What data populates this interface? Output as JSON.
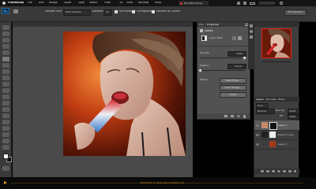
{
  "menu": {
    "app": "Photoshop",
    "items": [
      "File",
      "Edit",
      "Image",
      "Layer",
      "Type",
      "Select",
      "Filter",
      "3D",
      "View",
      "Window",
      "Help"
    ],
    "recording": "Now Recording"
  },
  "options": {
    "sample_size_label": "Sample Size:",
    "sample_size_value": "Point Sample",
    "tolerance_label": "Tolerance:",
    "tolerance_value": "32",
    "anti_alias": "Anti-alias",
    "contiguous": "Contiguous",
    "sample_all": "Sample All Layers",
    "workspace": "Photography"
  },
  "properties": {
    "tabs": [
      "Info",
      "Properties"
    ],
    "title": "Masks",
    "mask_type": "Layer Mask",
    "density_label": "Density:",
    "density_value": "100%",
    "feather_label": "Feather:",
    "feather_value": "0.0 px",
    "refine_label": "Refine:",
    "mask_edge_button": "Mask Edge...",
    "color_range_button": "Color Range...",
    "invert_button": "Invert"
  },
  "layers_panel": {
    "tabs": [
      "Layers",
      "Channels",
      "Paths"
    ],
    "kind": "Kind",
    "blend_mode": "Normal",
    "opacity_label": "Opacity:",
    "opacity_value": "100%",
    "fill_label": "Fill:",
    "fill_value": "100%",
    "layers": [
      {
        "name": "Layer 1"
      },
      {
        "name": "Layer 0 copy"
      },
      {
        "name": "Layer 0"
      }
    ]
  },
  "status": {
    "text": "Recorded on www.learncreative.com"
  }
}
